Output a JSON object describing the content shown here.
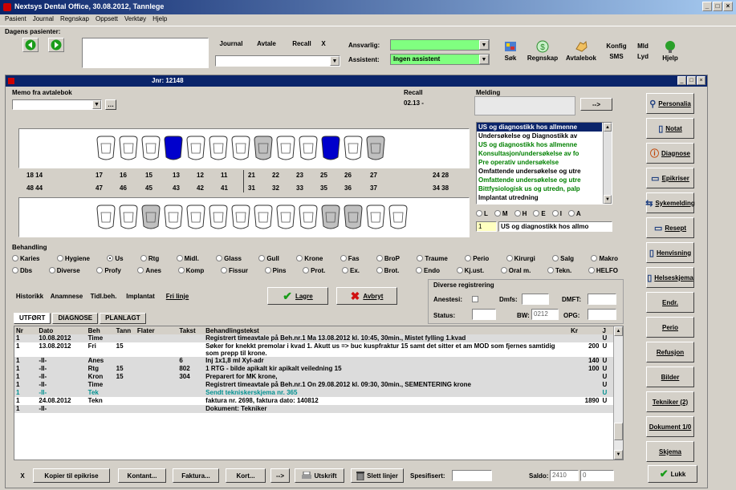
{
  "app": {
    "title": "Nextsys Dental Office, 30.08.2012, Tannlege",
    "menu": [
      "Pasient",
      "Journal",
      "Regnskap",
      "Oppsett",
      "Verktøy",
      "Hjelp"
    ]
  },
  "toolbar": {
    "dagens_label": "Dagens pasienter:",
    "journal": "Journal",
    "avtale": "Avtale",
    "recall": "Recall",
    "x": "X",
    "ansvarlig_label": "Ansvarlig:",
    "ansvarlig_value": "",
    "assistent_label": "Assistent:",
    "assistent_value": "Ingen assistent",
    "sok": "Søk",
    "regnskap": "Regnskap",
    "avtalebok": "Avtalebok",
    "konfig": "Konfig",
    "sms": "SMS",
    "mld": "Mld",
    "lyd": "Lyd",
    "hjelp": "Hjelp"
  },
  "journal": {
    "title": "Jnr: 12148",
    "memo_label": "Memo fra avtalebok",
    "recall_label": "Recall",
    "recall_value": "02.13 -",
    "melding_label": "Melding",
    "arrow": "-->"
  },
  "teeth": {
    "upper_left_nums": [
      "18 14",
      "17",
      "16",
      "15",
      "13",
      "12",
      "11"
    ],
    "upper_right_nums": [
      "21",
      "22",
      "23",
      "25",
      "26",
      "27",
      "24 28"
    ],
    "lower_left_nums": [
      "48 44",
      "47",
      "46",
      "45",
      "43",
      "42",
      "41"
    ],
    "lower_right_nums": [
      "31",
      "32",
      "33",
      "35",
      "36",
      "37",
      "34 38"
    ]
  },
  "diagnosis_list": [
    {
      "text": "US og diagnostikk hos allmenne",
      "style": "selected"
    },
    {
      "text": "Undersøkelse og Diagnostikk av",
      "style": "bold"
    },
    {
      "text": "US og diagnostikk hos allmenne",
      "style": "green"
    },
    {
      "text": "Konsultasjon/undersøkelse av fo",
      "style": "green"
    },
    {
      "text": "Pre operativ undersøkelse",
      "style": "green"
    },
    {
      "text": "Omfattende undersøkelse og utre",
      "style": "bold"
    },
    {
      "text": "Omfattende undersøkelse og utre",
      "style": "green"
    },
    {
      "text": "Bittfysiologisk us og utredn, palp",
      "style": "green"
    },
    {
      "text": "Implantat utredning",
      "style": "bold"
    }
  ],
  "surface_options": [
    "L",
    "M",
    "H",
    "E",
    "I",
    "A"
  ],
  "code_field": {
    "code": "1",
    "text": "US og diagnostikk hos allmo"
  },
  "behandling": {
    "label": "Behandling",
    "row1": [
      "Karies",
      "Hygiene",
      "Us",
      "Rtg",
      "Midl.",
      "Glass",
      "Gull",
      "Krone",
      "Fas",
      "BroP",
      "Traume",
      "Perio",
      "Kirurgi",
      "Salg",
      "Makro"
    ],
    "row2": [
      "Dbs",
      "Diverse",
      "Profy",
      "Anes",
      "Komp",
      "Fissur",
      "Pins",
      "Prot.",
      "Ex.",
      "Brot.",
      "Endo",
      "Kj.ust.",
      "Oral m.",
      "Tekn.",
      "HELFO"
    ],
    "selected": "Us"
  },
  "actions": {
    "historikk": "Historikk",
    "anamnese": "Anamnese",
    "tidl_beh": "Tidl.beh.",
    "implantat": "Implantat",
    "fri_linje": "Fri linje",
    "lagre": "Lagre",
    "avbryt": "Avbryt"
  },
  "diverse": {
    "label": "Diverse registrering",
    "anestesi": "Anestesi:",
    "dmfs": "Dmfs:",
    "dmft": "DMFT:",
    "status": "Status:",
    "bw": "BW:",
    "bw_value": "0212",
    "opg": "OPG:"
  },
  "tabs": [
    "UTFØRT",
    "DIAGNOSE",
    "PLANLAGT"
  ],
  "table": {
    "headers": [
      "Nr",
      "Dato",
      "Beh",
      "Tann",
      "Flater",
      "Takst",
      "Behandlingstekst",
      "Kr",
      "J"
    ],
    "rows": [
      {
        "nr": "1",
        "dato": "10.08.2012",
        "beh": "Time",
        "tann": "",
        "flater": "",
        "takst": "",
        "tekst": "Registrert timeavtale på Beh.nr.1  Ma 13.08.2012 kl. 10:45, 30min., Mistet fylling 1.kvad",
        "kr": "",
        "j": "U",
        "style": "gray"
      },
      {
        "nr": "1",
        "dato": "13.08.2012",
        "beh": "Fri",
        "tann": "15",
        "flater": "",
        "takst": "",
        "tekst": "Søker for knekkt premolar i kvad 1. Akutt us => buc kuspfraktur 15 samt det sitter et am MOD som fjernes samtidig som prepp til krone.",
        "kr": "200",
        "j": "U",
        "style": "white"
      },
      {
        "nr": "1",
        "dato": "-II-",
        "beh": "Anes",
        "tann": "",
        "flater": "",
        "takst": "6",
        "tekst": "Inj 1x1,8 ml Xyl-adr",
        "kr": "140",
        "j": "U",
        "style": "gray"
      },
      {
        "nr": "1",
        "dato": "-II-",
        "beh": "Rtg",
        "tann": "15",
        "flater": "",
        "takst": "802",
        "tekst": "1 RTG - bilde apikalt kir apikalt veiledning 15",
        "kr": "100",
        "j": "U",
        "style": "gray"
      },
      {
        "nr": "1",
        "dato": "-II-",
        "beh": "Kron",
        "tann": "15",
        "flater": "",
        "takst": "304",
        "tekst": "Preparert for MK krone,",
        "kr": "",
        "j": "U",
        "style": "gray"
      },
      {
        "nr": "1",
        "dato": "-II-",
        "beh": "Time",
        "tann": "",
        "flater": "",
        "takst": "",
        "tekst": "Registrert timeavtale på Beh.nr.1  On 29.08.2012 kl. 09:30, 30min., SEMENTERING krone",
        "kr": "",
        "j": "U",
        "style": "gray"
      },
      {
        "nr": "1",
        "dato": "-II-",
        "beh": "Tek",
        "tann": "",
        "flater": "",
        "takst": "",
        "tekst": "Sendt tekniskerskjema nr. 365",
        "kr": "",
        "j": "U",
        "style": "teal"
      },
      {
        "nr": "1",
        "dato": "24.08.2012",
        "beh": "Tekn",
        "tann": "",
        "flater": "",
        "takst": "",
        "tekst": "faktura nr. 2698, faktura dato: 140812",
        "kr": "1890",
        "j": "U",
        "style": "white"
      },
      {
        "nr": "1",
        "dato": "-II-",
        "beh": "",
        "tann": "",
        "flater": "",
        "takst": "",
        "tekst": "Dokument: Tekniker",
        "kr": "",
        "j": "",
        "style": "gray"
      }
    ]
  },
  "bottom": {
    "x": "X",
    "kopier": "Kopier til epikrise",
    "kontant": "Kontant...",
    "faktura": "Faktura...",
    "kort": "Kort...",
    "arrow": "-->",
    "utskrift": "Utskrift",
    "slett": "Slett linjer",
    "spesifisert": "Spesifisert:",
    "saldo": "Saldo:",
    "saldo_value": "2410",
    "saldo_value2": "0",
    "lukk": "Lukk"
  },
  "side_buttons": [
    "Personalia",
    "Notat",
    "Diagnose",
    "Epikriser",
    "Sykemelding",
    "Resept",
    "Henvisning",
    "Helseskjema",
    "Endr.",
    "Perio",
    "Refusjon",
    "Bilder",
    "Tekniker (2)",
    "Dokument 1/0",
    "Skjema"
  ],
  "colors": {
    "blue_tooth": "#0000cc",
    "green_field": "#80ff80",
    "title_blue": "#0a246a"
  }
}
